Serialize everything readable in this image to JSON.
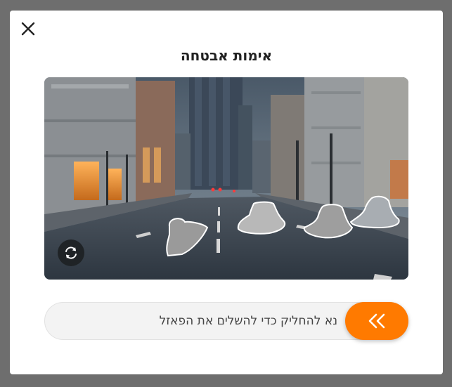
{
  "dialog": {
    "title": "אימות אבטחה",
    "close_icon": "close-icon"
  },
  "puzzle": {
    "refresh_icon": "refresh-icon",
    "shapes": [
      "hat",
      "hat",
      "hat",
      "hat"
    ]
  },
  "slider": {
    "instruction": "נא להחליק כדי להשלים את הפאזל",
    "handle_icon": "double-chevron-left-icon",
    "accent_color": "#ff7a00"
  }
}
